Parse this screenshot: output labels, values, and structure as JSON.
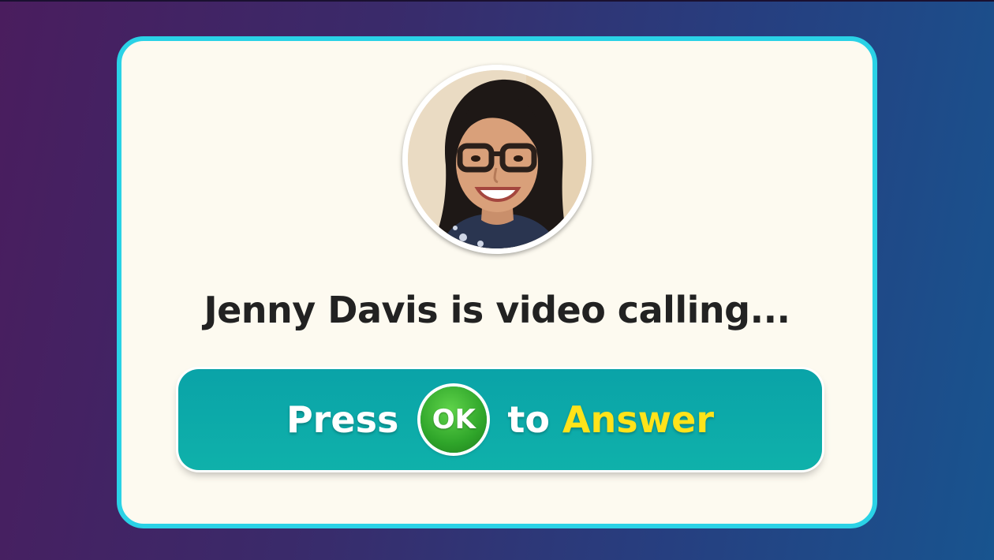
{
  "call": {
    "caller_name": "Jenny Davis",
    "message": "Jenny Davis is video calling...",
    "avatar_icon": "caller-photo"
  },
  "answer_button": {
    "prefix": "Press",
    "key_label": "OK",
    "middle": "to",
    "action": "Answer"
  },
  "colors": {
    "card_border": "#2ad2e6",
    "card_background": "#fdfaf0",
    "button_background": "#0fb1aa",
    "ok_badge": "#2fa52a",
    "action_text": "#ffe31a"
  }
}
